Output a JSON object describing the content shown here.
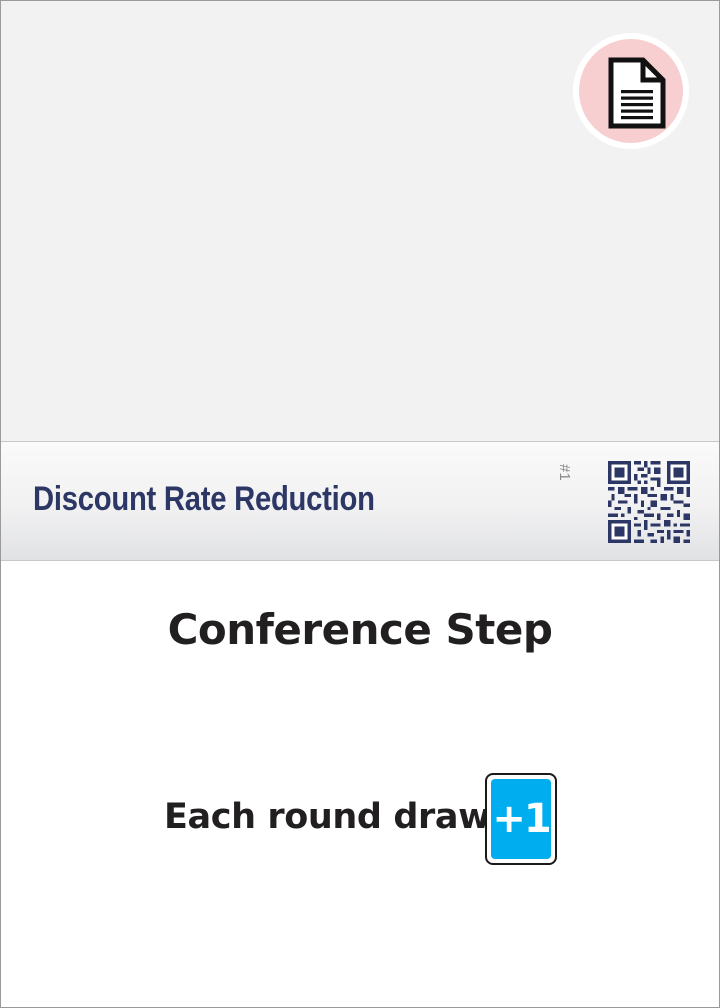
{
  "card": {
    "title": "Discount Rate Reduction",
    "number": "#1",
    "type_icon": "document-icon",
    "step": "Conference Step",
    "effect_text": "Each round draw",
    "draw_amount": "+1"
  },
  "colors": {
    "title": "#2c3766",
    "badge_circle": "#f8cfd0",
    "draw_token": "#00aeef",
    "qr": "#2c3766",
    "art_background": "#f2f2f2"
  }
}
